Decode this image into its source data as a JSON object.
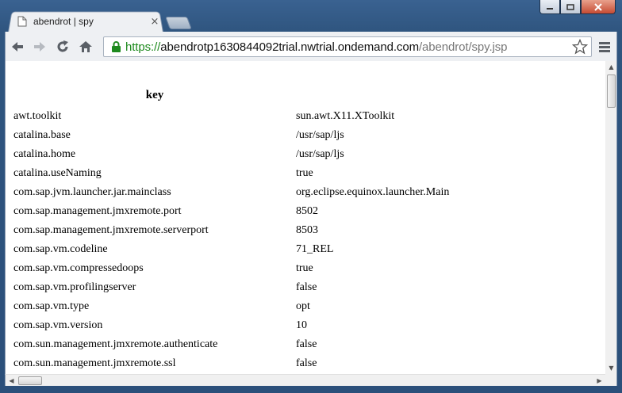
{
  "window": {
    "minimize_icon": "minimize-icon",
    "maximize_icon": "maximize-icon",
    "close_icon": "close-icon"
  },
  "tab": {
    "title": "abendrot | spy",
    "close_label": "×"
  },
  "omnibox": {
    "scheme": "https://",
    "host": "abendrotp1630844092trial.nwtrial.ondemand.com",
    "path": "/abendrot/spy.jsp",
    "secure_color": "#1e8a1e"
  },
  "table": {
    "header_key": "key",
    "rows": [
      {
        "key": "awt.toolkit",
        "value": "sun.awt.X11.XToolkit"
      },
      {
        "key": "catalina.base",
        "value": "/usr/sap/ljs"
      },
      {
        "key": "catalina.home",
        "value": "/usr/sap/ljs"
      },
      {
        "key": "catalina.useNaming",
        "value": "true"
      },
      {
        "key": "com.sap.jvm.launcher.jar.mainclass",
        "value": "org.eclipse.equinox.launcher.Main"
      },
      {
        "key": "com.sap.management.jmxremote.port",
        "value": "8502"
      },
      {
        "key": "com.sap.management.jmxremote.serverport",
        "value": "8503"
      },
      {
        "key": "com.sap.vm.codeline",
        "value": "71_REL"
      },
      {
        "key": "com.sap.vm.compressedoops",
        "value": "true"
      },
      {
        "key": "com.sap.vm.profilingserver",
        "value": "false"
      },
      {
        "key": "com.sap.vm.type",
        "value": "opt"
      },
      {
        "key": "com.sap.vm.version",
        "value": "10"
      },
      {
        "key": "com.sun.management.jmxremote.authenticate",
        "value": "false"
      },
      {
        "key": "com.sun.management.jmxremote.ssl",
        "value": "false"
      }
    ]
  }
}
